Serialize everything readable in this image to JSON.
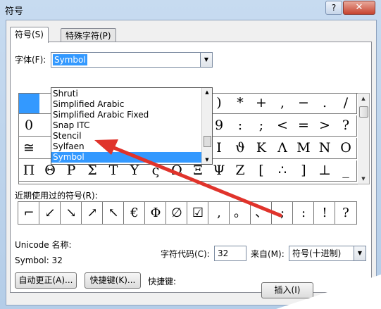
{
  "window": {
    "title": "符号",
    "help": "?",
    "close": "✕"
  },
  "tabs": [
    {
      "label": "符号(S)"
    },
    {
      "label": "特殊字符(P)"
    }
  ],
  "font": {
    "label": "字体(F):",
    "value": "Symbol"
  },
  "font_dropdown": {
    "items": [
      "Shruti",
      "Simplified Arabic",
      "Simplified Arabic Fixed",
      "Snap ITC",
      "Stencil",
      "Sylfaen",
      "Symbol"
    ],
    "selected": "Symbol"
  },
  "symbol_grid": {
    "rows": [
      [
        "",
        "",
        "",
        "",
        "",
        "",
        "",
        "",
        "",
        ")",
        "*",
        "+",
        ",",
        "−",
        ".",
        "/"
      ],
      [
        "0",
        "",
        "",
        "",
        "",
        "",
        "",
        "",
        "",
        "9",
        ":",
        ";",
        "<",
        "=",
        ">",
        "?"
      ],
      [
        "≅",
        "",
        "",
        "",
        "",
        "",
        "",
        "",
        "",
        "I",
        "ϑ",
        "Κ",
        "Λ",
        "Μ",
        "Ν",
        "Ο"
      ],
      [
        "Π",
        "Θ",
        "Ρ",
        "Σ",
        "Τ",
        "Υ",
        "ς",
        "Ω",
        "Ξ",
        "Ψ",
        "Ζ",
        "[",
        "∴",
        "]",
        "⊥",
        "_"
      ]
    ]
  },
  "recent": {
    "label": "近期使用过的符号(R):",
    "symbols": [
      "⌐",
      "↙",
      "↘",
      "↗",
      "↖",
      "€",
      "Φ",
      "∅",
      "☑",
      ",",
      "。",
      "、",
      ";",
      ":",
      "!",
      "?"
    ]
  },
  "unicode_name": {
    "label": "Unicode 名称:",
    "value": "Symbol: 32"
  },
  "char_code": {
    "label": "字符代码(C):",
    "value": "32"
  },
  "from": {
    "label": "来自(M):",
    "value": "符号(十进制)"
  },
  "buttons": {
    "autocorrect": "自动更正(A)...",
    "shortcut": "快捷键(K)...",
    "shortcut_label": "快捷键:",
    "insert": "插入(I)"
  },
  "colors": {
    "accent": "#3399ff",
    "annotation_arrow": "#e0332b"
  }
}
